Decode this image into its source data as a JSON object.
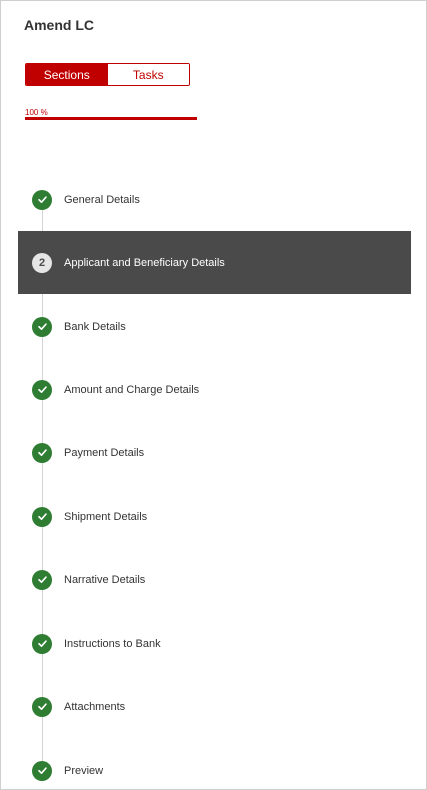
{
  "header": {
    "title": "Amend LC"
  },
  "toggle": {
    "sections_label": "Sections",
    "tasks_label": "Tasks",
    "active": "Sections"
  },
  "progress": {
    "label": "100 %",
    "value": 100
  },
  "steps": [
    {
      "label": "General Details",
      "status": "done"
    },
    {
      "label": "Applicant and Beneficiary Details",
      "status": "active",
      "number": "2"
    },
    {
      "label": "Bank Details",
      "status": "done"
    },
    {
      "label": "Amount and Charge Details",
      "status": "done"
    },
    {
      "label": "Payment Details",
      "status": "done"
    },
    {
      "label": "Shipment Details",
      "status": "done"
    },
    {
      "label": "Narrative Details",
      "status": "done"
    },
    {
      "label": "Instructions to Bank",
      "status": "done"
    },
    {
      "label": "Attachments",
      "status": "done"
    },
    {
      "label": "Preview",
      "status": "done"
    }
  ],
  "colors": {
    "accent": "#c00000",
    "done": "#2e7d32",
    "active_row": "#4a4a4a"
  },
  "icons": {
    "done": "check-circle-icon",
    "active": "number-circle-icon"
  }
}
